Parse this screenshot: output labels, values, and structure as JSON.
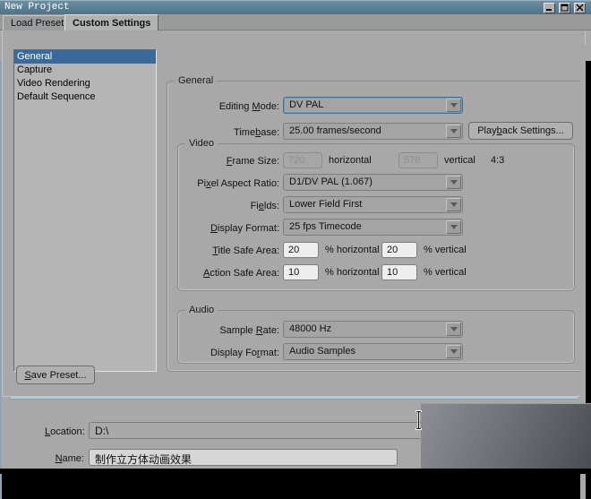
{
  "window": {
    "title": "New Project",
    "buttons": {
      "minimize": "minimize-button",
      "maximize": "maximize-button",
      "close": "close-button"
    }
  },
  "tabs": [
    {
      "label": "Load Preset",
      "active": false
    },
    {
      "label": "Custom Settings",
      "active": true
    }
  ],
  "sidebar": {
    "items": [
      {
        "label": "General",
        "selected": true
      },
      {
        "label": "Capture",
        "selected": false
      },
      {
        "label": "Video Rendering",
        "selected": false
      },
      {
        "label": "Default Sequence",
        "selected": false
      }
    ]
  },
  "groups": {
    "general": {
      "title": "General"
    },
    "video": {
      "title": "Video"
    },
    "audio": {
      "title": "Audio"
    }
  },
  "general": {
    "editing_mode": {
      "label": "Editing Mode:",
      "accel": "M",
      "value": "DV PAL"
    },
    "timebase": {
      "label": "Timebase:",
      "accel": "b",
      "value": "25.00 frames/second"
    },
    "playback_settings_button": {
      "label": "Playback Settings...",
      "accel": "b"
    }
  },
  "video": {
    "frame_size": {
      "label": "Frame Size:",
      "accel": "F",
      "horizontal_value": "720",
      "horizontal_unit": "horizontal",
      "vertical_value": "576",
      "vertical_unit": "vertical",
      "aspect": "4:3"
    },
    "pixel_aspect_ratio": {
      "label": "Pixel Aspect Ratio:",
      "accel": "x",
      "value": "D1/DV PAL (1.067)"
    },
    "fields": {
      "label": "Fields:",
      "accel": "e",
      "value": "Lower Field First"
    },
    "display_format": {
      "label": "Display Format:",
      "accel": "D",
      "value": "25 fps Timecode"
    },
    "title_safe_area": {
      "label": "Title Safe Area:",
      "accel": "T",
      "horizontal_value": "20",
      "horizontal_unit": "% horizontal",
      "vertical_value": "20",
      "vertical_unit": "% vertical"
    },
    "action_safe_area": {
      "label": "Action Safe Area:",
      "accel": "A",
      "horizontal_value": "10",
      "horizontal_unit": "% horizontal",
      "vertical_value": "10",
      "vertical_unit": "% vertical"
    }
  },
  "audio": {
    "sample_rate": {
      "label": "Sample Rate:",
      "accel": "R",
      "value": "48000 Hz"
    },
    "display_format": {
      "label": "Display Format:",
      "accel": "r",
      "value": "Audio Samples"
    }
  },
  "save_preset_button": {
    "label": "Save Preset...",
    "accel": "S"
  },
  "bottom": {
    "location": {
      "label": "Location:",
      "accel": "L",
      "value": "D:\\"
    },
    "name": {
      "label": "Name:",
      "accel": "N",
      "value": "制作立方体动画效果"
    }
  },
  "colors": {
    "titlebar": "#5d8298",
    "dialog_bg": "#a8a8a8",
    "selection": "#3a6a9a",
    "focus_border": "#3f6f9f",
    "separator": "#b6cad6"
  }
}
